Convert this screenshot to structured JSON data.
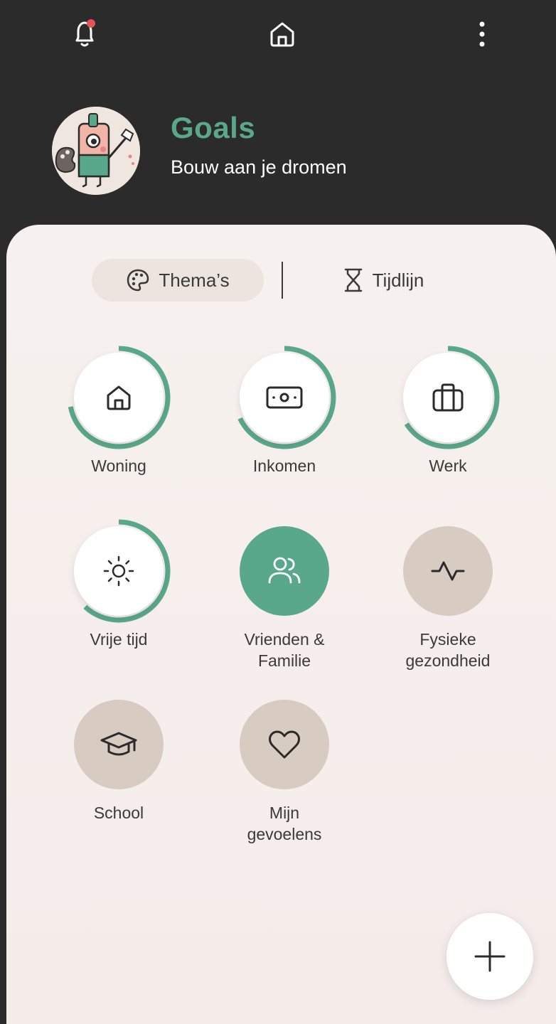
{
  "colors": {
    "accent": "#5aa88c",
    "header_bg": "#2b2b2b",
    "panel_bg": "#f6f1ee",
    "inactive_circle": "#d8cbc2",
    "notification_dot": "#e05555"
  },
  "topbar": {
    "left_icon": "bell-icon",
    "center_icon": "home-icon",
    "right_icon": "more-vertical-icon"
  },
  "header": {
    "title": "Goals",
    "subtitle": "Bouw aan je dromen"
  },
  "tabs": [
    {
      "label": "Thema’s",
      "icon": "palette-icon",
      "active": true
    },
    {
      "label": "Tijdlijn",
      "icon": "hourglass-icon",
      "active": false
    }
  ],
  "themes": [
    {
      "label": "Woning",
      "icon": "home-icon",
      "style": "white",
      "progress": 0.72
    },
    {
      "label": "Inkomen",
      "icon": "banknote-icon",
      "style": "white",
      "progress": 0.68
    },
    {
      "label": "Werk",
      "icon": "briefcase-icon",
      "style": "white",
      "progress": 0.66
    },
    {
      "label": "Vrije tijd",
      "icon": "sun-icon",
      "style": "white",
      "progress": 0.62
    },
    {
      "label": "Vrienden &\nFamilie",
      "icon": "users-icon",
      "style": "green",
      "progress": 0
    },
    {
      "label": "Fysieke\ngezondheid",
      "icon": "activity-icon",
      "style": "beige",
      "progress": 0
    },
    {
      "label": "School",
      "icon": "graduation-cap-icon",
      "style": "beige",
      "progress": 0
    },
    {
      "label": "Mijn\ngevoelens",
      "icon": "heart-icon",
      "style": "beige",
      "progress": 0
    }
  ],
  "fab": {
    "icon": "plus-icon"
  }
}
